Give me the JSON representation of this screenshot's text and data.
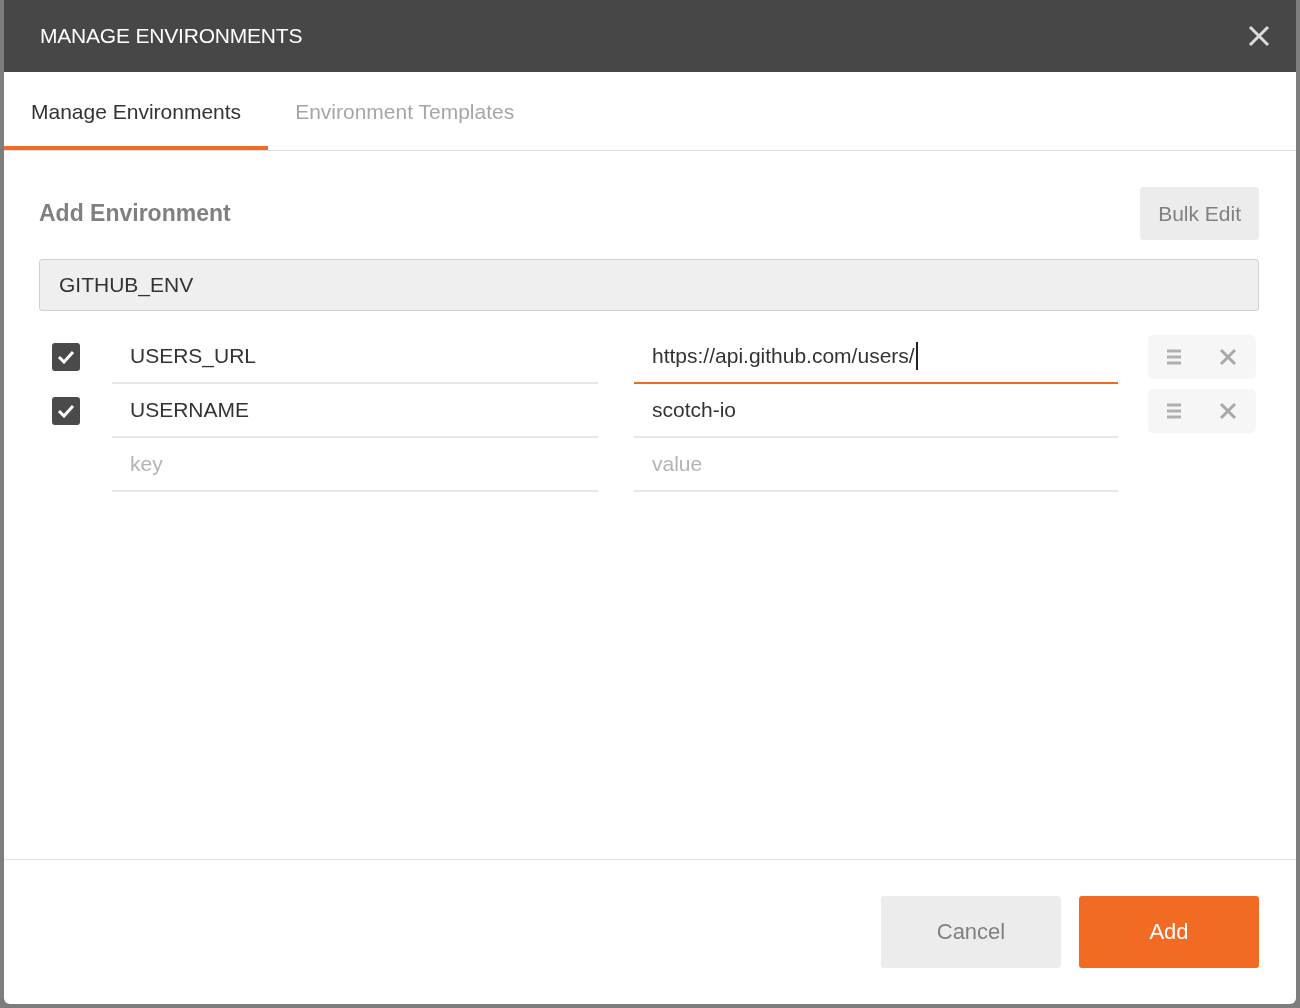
{
  "dialog": {
    "title": "MANAGE ENVIRONMENTS"
  },
  "tabs": [
    {
      "label": "Manage Environments",
      "selected": true
    },
    {
      "label": "Environment Templates",
      "selected": false
    }
  ],
  "section_title": "Add Environment",
  "bulk_edit_button": "Bulk Edit",
  "environment_name": {
    "value": "GITHUB_ENV"
  },
  "variables": [
    {
      "enabled": true,
      "key": "USERS_URL",
      "value": "https://api.github.com/users/",
      "focused": true
    },
    {
      "enabled": true,
      "key": "USERNAME",
      "value": "scotch-io",
      "focused": false
    }
  ],
  "new_variable": {
    "key_placeholder": "key",
    "value_placeholder": "value"
  },
  "buttons": [
    {
      "label": "Cancel",
      "kind": "secondary"
    },
    {
      "label": "Add",
      "kind": "primary"
    }
  ]
}
